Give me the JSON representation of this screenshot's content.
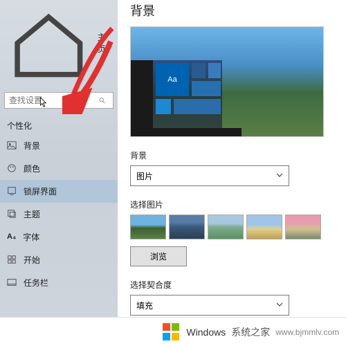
{
  "sidebar": {
    "search_placeholder": "查找设置",
    "section": "个性化",
    "truncated": "主页",
    "items": [
      {
        "label": "背景"
      },
      {
        "label": "颜色"
      },
      {
        "label": "锁屏界面"
      },
      {
        "label": "主题"
      },
      {
        "label": "字体"
      },
      {
        "label": "开始"
      },
      {
        "label": "任务栏"
      }
    ]
  },
  "main": {
    "title": "背景",
    "preview_text": "Aa",
    "bg_label": "背景",
    "bg_value": "图片",
    "pick_label": "选择图片",
    "browse": "浏览",
    "fit_label": "选择契合度",
    "fit_value": "填充"
  },
  "footer": {
    "brand1": "Windows",
    "brand2": "系统之家",
    "url": "www.bjmmlv.com"
  }
}
